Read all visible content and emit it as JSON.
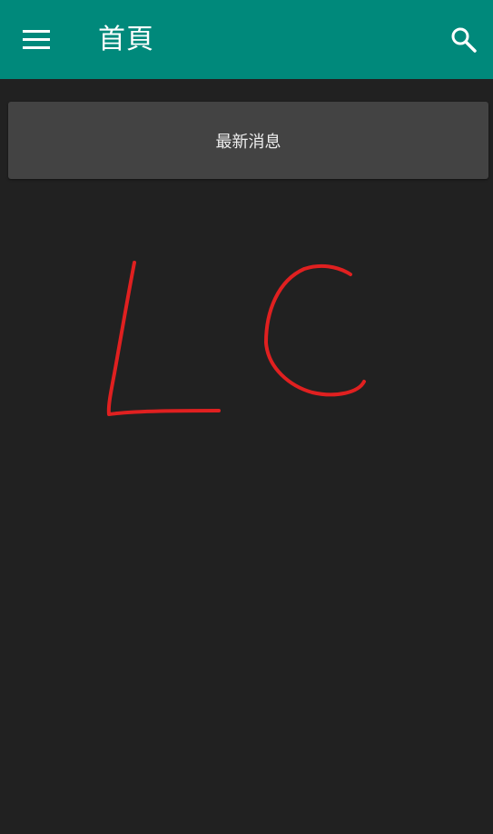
{
  "app_bar": {
    "title": "首頁",
    "background_color": "#00897b",
    "menu_icon": "hamburger-menu-icon",
    "search_icon": "search-icon"
  },
  "content": {
    "news_button_label": "最新消息",
    "background_color": "#212121"
  },
  "drawing": {
    "stroke_color": "#e02020",
    "text": "LC"
  }
}
